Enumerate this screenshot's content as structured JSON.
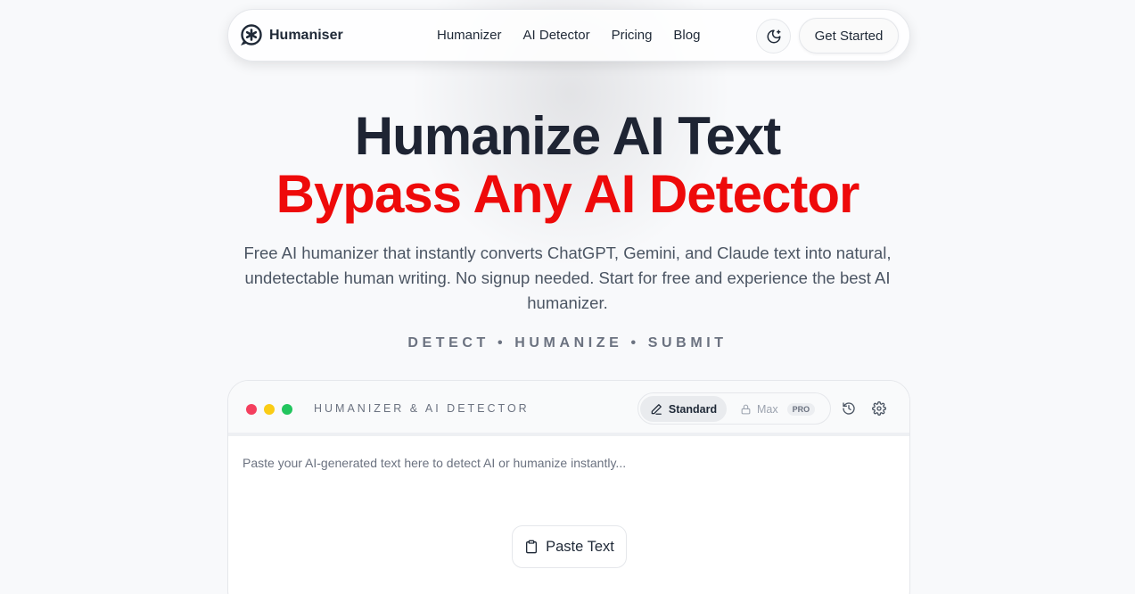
{
  "nav": {
    "brand": "Humaniser",
    "links": [
      "Humanizer",
      "AI Detector",
      "Pricing",
      "Blog"
    ],
    "theme_icon": "moon-icon",
    "cta": "Get Started"
  },
  "hero": {
    "title": "Humanize AI Text",
    "subtitle": "Bypass Any AI Detector",
    "description": "Free AI humanizer that instantly converts ChatGPT, Gemini, and Claude text into natural, undetectable human writing. No signup needed. Start for free and experience the best AI humanizer.",
    "tagline": "DETECT • HUMANIZE • SUBMIT",
    "subtitle_color": "#ee0a0a"
  },
  "tool": {
    "title": "HUMANIZER & AI DETECTOR",
    "window_dots": [
      "#f43f5e",
      "#facc15",
      "#22c55e"
    ],
    "modes": {
      "standard": "Standard",
      "max": "Max",
      "max_badge": "PRO"
    },
    "placeholder": "Paste your AI-generated text here to detect AI or humanize instantly...",
    "paste_button": "Paste Text"
  }
}
